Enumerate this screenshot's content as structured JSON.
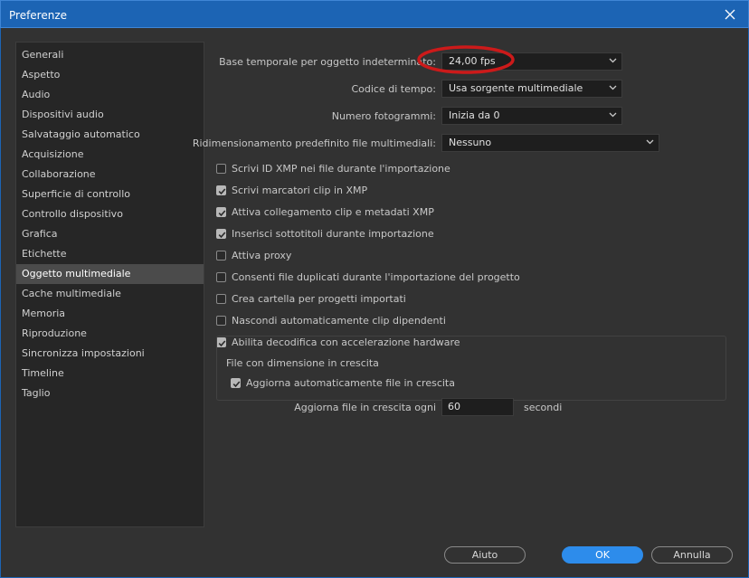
{
  "window": {
    "title": "Preferenze"
  },
  "sidebar": {
    "items": [
      {
        "label": "Generali"
      },
      {
        "label": "Aspetto"
      },
      {
        "label": "Audio"
      },
      {
        "label": "Dispositivi audio"
      },
      {
        "label": "Salvataggio automatico"
      },
      {
        "label": "Acquisizione"
      },
      {
        "label": "Collaborazione"
      },
      {
        "label": "Superficie di controllo"
      },
      {
        "label": "Controllo dispositivo"
      },
      {
        "label": "Grafica"
      },
      {
        "label": "Etichette"
      },
      {
        "label": "Oggetto multimediale"
      },
      {
        "label": "Cache multimediale"
      },
      {
        "label": "Memoria"
      },
      {
        "label": "Riproduzione"
      },
      {
        "label": "Sincronizza impostazioni"
      },
      {
        "label": "Timeline"
      },
      {
        "label": "Taglio"
      }
    ],
    "selected": "Oggetto multimediale"
  },
  "fields": {
    "timebase": {
      "label": "Base temporale per oggetto indeterminato:",
      "value": "24,00  fps"
    },
    "timecode": {
      "label": "Codice di tempo:",
      "value": "Usa sorgente multimediale"
    },
    "framecount": {
      "label": "Numero fotogrammi:",
      "value": "Inizia da 0"
    },
    "scaling": {
      "label": "Ridimensionamento predefinito file multimediali:",
      "value": "Nessuno"
    }
  },
  "checkboxes": [
    {
      "label": "Scrivi ID XMP nei file durante l'importazione",
      "checked": false
    },
    {
      "label": "Scrivi marcatori clip in XMP",
      "checked": true
    },
    {
      "label": "Attiva collegamento clip e metadati XMP",
      "checked": true
    },
    {
      "label": "Inserisci sottotitoli durante importazione",
      "checked": true
    },
    {
      "label": "Attiva proxy",
      "checked": false
    },
    {
      "label": "Consenti file duplicati durante l'importazione del progetto",
      "checked": false
    },
    {
      "label": "Crea cartella per progetti importati",
      "checked": false
    },
    {
      "label": "Nascondi automaticamente clip dipendenti",
      "checked": false
    },
    {
      "label": "Abilita decodifica con accelerazione hardware",
      "checked": true
    }
  ],
  "growing": {
    "title": "File con dimensione in crescita",
    "auto_refresh": {
      "label": "Aggiorna automaticamente file in crescita",
      "checked": true
    },
    "interval_label": "Aggiorna file in crescita ogni",
    "interval_value": "60",
    "interval_unit": "secondi"
  },
  "buttons": {
    "help": "Aiuto",
    "ok": "OK",
    "cancel": "Annulla"
  },
  "colors": {
    "titlebar": "#1c64b4",
    "accent": "#2d8ceb",
    "annotation": "#cc1a1a"
  },
  "icons": {
    "close": "close-icon",
    "dropdown": "chevron-down-icon",
    "check": "checkmark-icon"
  }
}
